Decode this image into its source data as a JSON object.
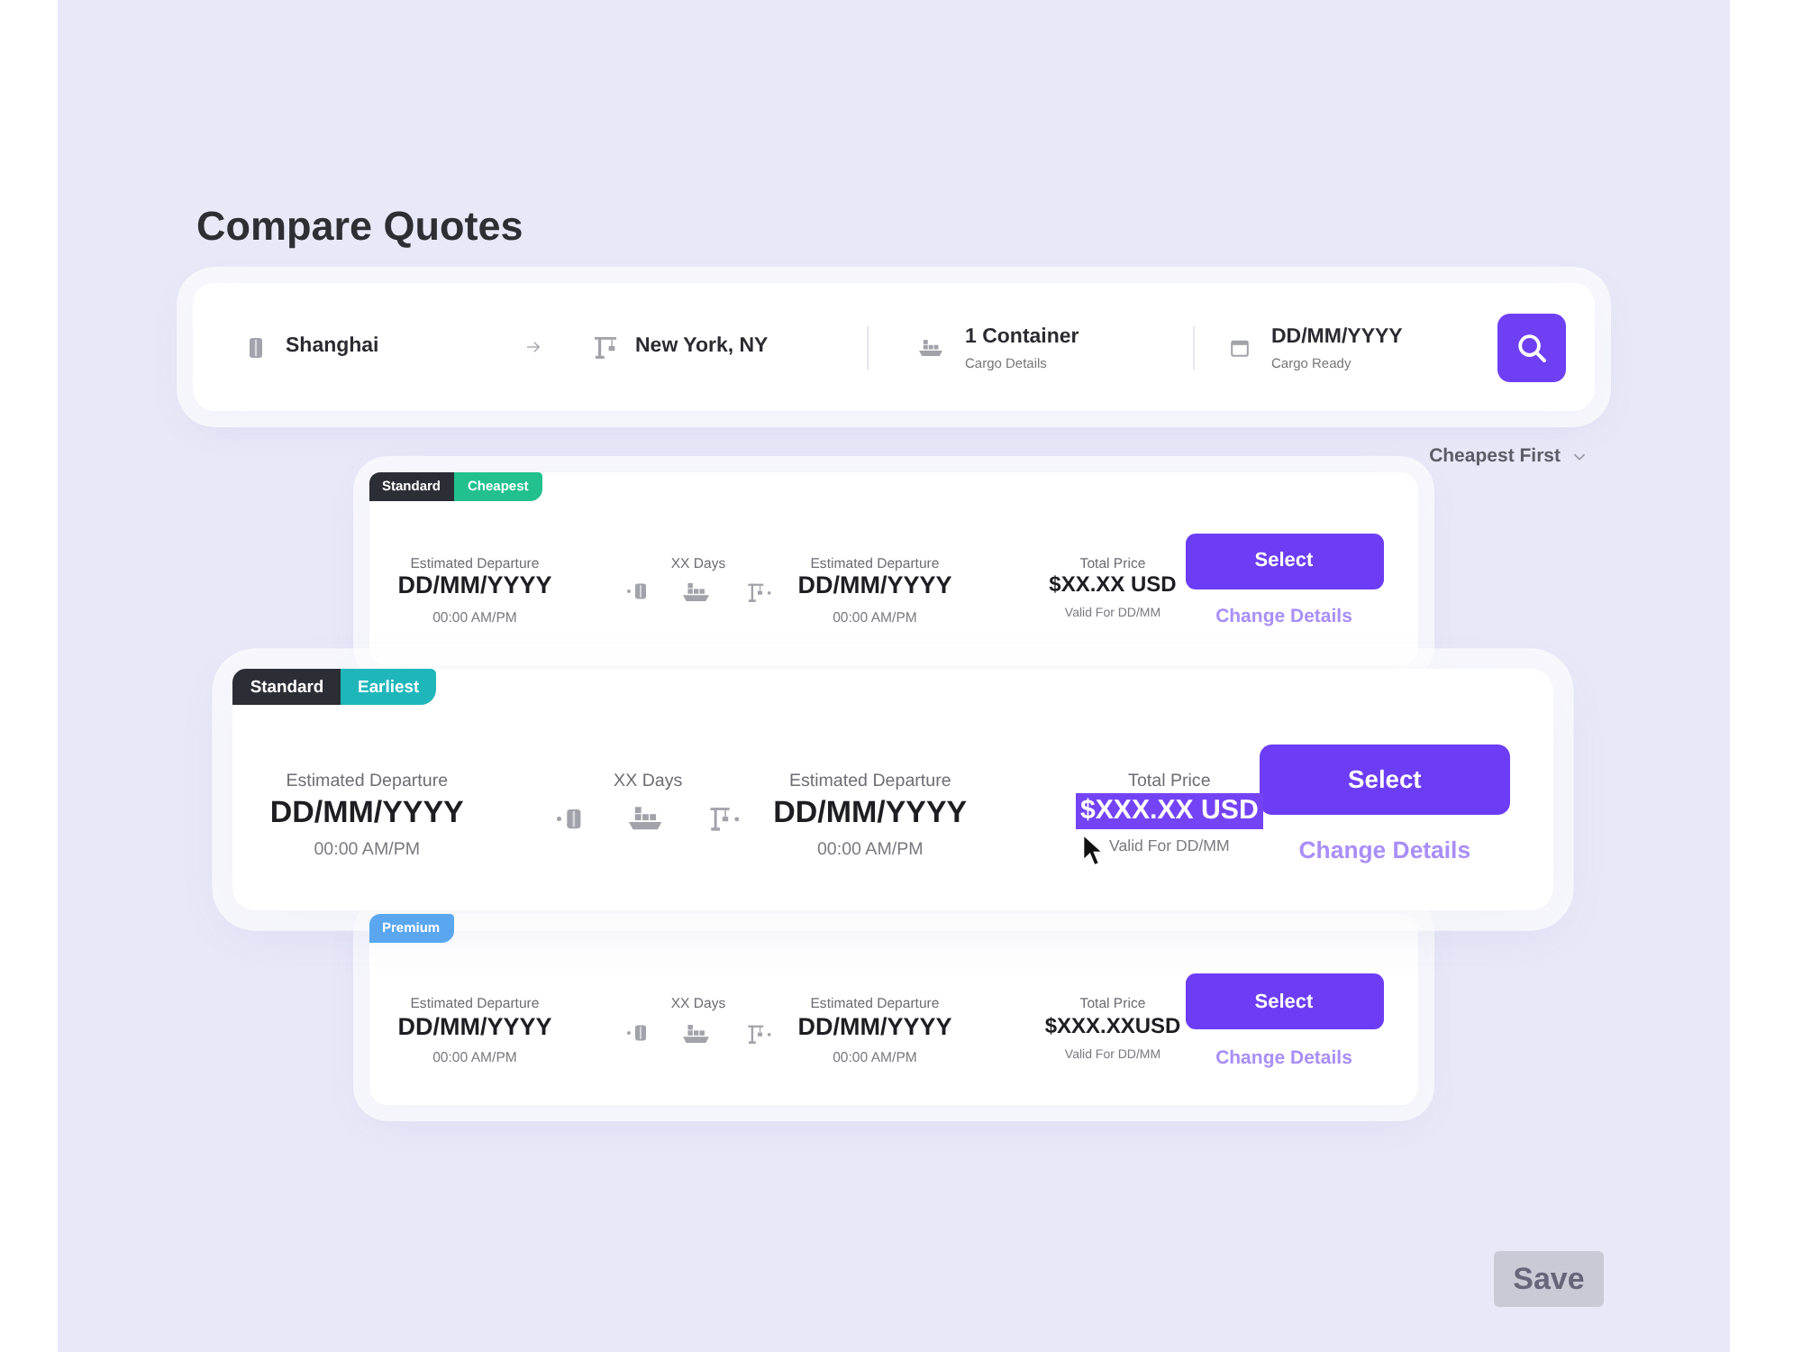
{
  "page": {
    "title": "Compare Quotes"
  },
  "search_bar": {
    "origin": "Shanghai",
    "destination": "New York, NY",
    "cargo": {
      "value": "1 Container",
      "label": "Cargo Details"
    },
    "ready_date": {
      "value": "DD/MM/YYYY",
      "label": "Cargo Ready"
    }
  },
  "sort": {
    "value": "Cheapest First"
  },
  "quotes": [
    {
      "hovered": false,
      "price_selected": false,
      "tags": [
        {
          "label": "Standard",
          "color": "#2b2e35"
        },
        {
          "label": "Cheapest",
          "color": "#22c08f"
        }
      ],
      "origin_estimate": {
        "label": "Estimated Departure",
        "date": "DD/MM/YYYY",
        "time": "00:00 AM/PM"
      },
      "duration": "XX Days",
      "destination_estimate": {
        "label": "Estimated Departure",
        "date": "DD/MM/YYYY",
        "time": "00:00 AM/PM"
      },
      "price": {
        "label": "Total Price",
        "amount": "$XX.XX USD",
        "validity": "Valid For DD/MM"
      },
      "select_label": "Select",
      "change_label": "Change Details"
    },
    {
      "hovered": true,
      "price_selected": true,
      "tags": [
        {
          "label": "Standard",
          "color": "#2b2e35"
        },
        {
          "label": "Earliest",
          "color": "#1fb6ba"
        }
      ],
      "origin_estimate": {
        "label": "Estimated Departure",
        "date": "DD/MM/YYYY",
        "time": "00:00 AM/PM"
      },
      "duration": "XX Days",
      "destination_estimate": {
        "label": "Estimated Departure",
        "date": "DD/MM/YYYY",
        "time": "00:00 AM/PM"
      },
      "price": {
        "label": "Total Price",
        "amount": "$XXX.XX USD",
        "validity": "Valid For DD/MM"
      },
      "select_label": "Select",
      "change_label": "Change Details"
    },
    {
      "hovered": false,
      "price_selected": false,
      "tags": [
        {
          "label": "Premium",
          "color": "#5aa7f0"
        }
      ],
      "origin_estimate": {
        "label": "Estimated Departure",
        "date": "DD/MM/YYYY",
        "time": "00:00 AM/PM"
      },
      "duration": "XX Days",
      "destination_estimate": {
        "label": "Estimated Departure",
        "date": "DD/MM/YYYY",
        "time": "00:00 AM/PM"
      },
      "price": {
        "label": "Total Price",
        "amount": "$XXX.XXUSD",
        "validity": "Valid For DD/MM"
      },
      "select_label": "Select",
      "change_label": "Change Details"
    }
  ],
  "save": {
    "label": "Save",
    "disabled": true
  }
}
